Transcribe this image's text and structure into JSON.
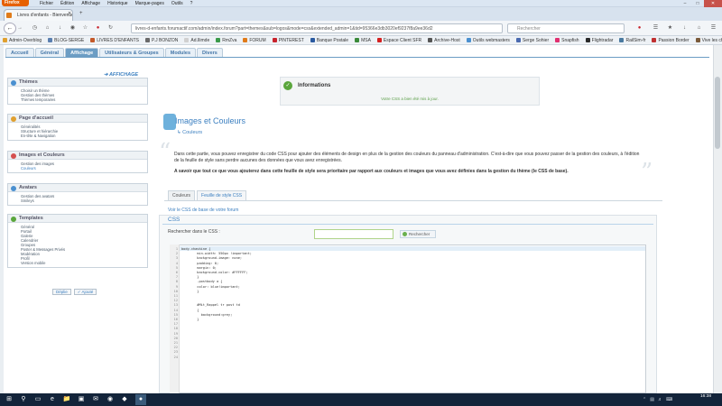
{
  "browser": {
    "app_button": "Firefox",
    "menus": [
      "Fichier",
      "Édition",
      "Affichage",
      "Historique",
      "Marque-pages",
      "Outils",
      "?"
    ],
    "tab_title": "Livres d'enfants - Bienvenue s...",
    "url": "livres-d-enfants.forumactif.com/admin/index.forum?part=themes&sub=logos&mode=css&extended_admin=1&tid=95366e3db3020ef9237f8a9ee36d2",
    "search_placeholder": "Rechercher",
    "bookmarks": [
      {
        "label": "Admin-Overblog",
        "color": "#e0a030"
      },
      {
        "label": "BLOG-SERGE",
        "color": "#5a7fb0"
      },
      {
        "label": "LIVRES D'ENFANTS",
        "color": "#c45a2a"
      },
      {
        "label": "P.J BONZON",
        "color": "#6a6a6a"
      },
      {
        "label": "Ad.Ilimde",
        "color": "#d0d0d0"
      },
      {
        "label": "RmZva",
        "color": "#3a9a4a"
      },
      {
        "label": "FORUM",
        "color": "#e07b1a"
      },
      {
        "label": "PINTEREST",
        "color": "#c8232c"
      },
      {
        "label": "Banque Postale",
        "color": "#2a5aa0"
      },
      {
        "label": "MSA",
        "color": "#3a8a3a"
      },
      {
        "label": "Espace Client SFR",
        "color": "#d52020"
      },
      {
        "label": "Archive-Host",
        "color": "#555555"
      },
      {
        "label": "Outils webmasters",
        "color": "#4a90d0"
      },
      {
        "label": "Serge Sohier",
        "color": "#4a6ab0"
      },
      {
        "label": "Snapfish",
        "color": "#e03070"
      },
      {
        "label": "Flightradar",
        "color": "#2a2a2a"
      },
      {
        "label": "RailSim-fr",
        "color": "#4a7aa0"
      },
      {
        "label": "Passion Border",
        "color": "#c03030"
      },
      {
        "label": "Vive les chiens",
        "color": "#7a5a3a"
      }
    ]
  },
  "admin": {
    "tabs": [
      "Accueil",
      "Général",
      "Affichage",
      "Utilisateurs & Groupes",
      "Modules",
      "Divers"
    ],
    "active_tab": "Affichage",
    "section_link": "AFFICHAGE",
    "sidebar": [
      {
        "title": "Thèmes",
        "icon_color": "#4a90d0",
        "items": [
          "Choisir un thème",
          "Gestion des thèmes",
          "Thèmes temporaires"
        ]
      },
      {
        "title": "Page d'accueil",
        "icon_color": "#e0a030",
        "items": [
          "Généralités",
          "Structure et hiérarchie",
          "En-tête & Navigation"
        ]
      },
      {
        "title": "Images et Couleurs",
        "icon_color": "#d55050",
        "items": [
          "Gestion des images",
          "Couleurs"
        ],
        "selected": "Couleurs"
      },
      {
        "title": "Avatars",
        "icon_color": "#4a90d0",
        "items": [
          "Gestion des avatars",
          "Smileys"
        ]
      },
      {
        "title": "Templates",
        "icon_color": "#5aa63c",
        "items": [
          "Général",
          "Portail",
          "Galerie",
          "Calendrier",
          "Groupes",
          "Poster & Messages Privés",
          "Modération",
          "Profil",
          "Version mobile"
        ]
      }
    ],
    "buttons": {
      "collapse": "Déplie",
      "expand": "Ajouté"
    }
  },
  "main": {
    "info_title": "Informations",
    "info_text": "Votre CSS a bien été mis à jour.",
    "page_title": "Images et Couleurs",
    "subtitle": "Couleurs",
    "desc1": "Dans cette partie, vous pouvez enregistrer du code CSS pour ajouter des éléments de design en plus de la gestion des couleurs du panneau d'administration. C'est-à-dire que vous pouvez passer de la gestion des couleurs, à l'édition de la feuille de style sans perdre aucunes des données que vous avez enregistrées.",
    "desc2": "A savoir que tout ce que vous ajouterez dans cette feuille de style sera prioritaire par rapport aux couleurs et images que vous avez définies dans la gestion du thème (le CSS de base).",
    "subtabs": [
      "Couleurs",
      "Feuille de style CSS"
    ],
    "css_base_link": "Voir le CSS de base de votre forum",
    "css_panel_title": "CSS",
    "search_label": "Rechercher dans le CSS :",
    "search_button": "Rechercher",
    "code_lines": [
      "body.chaskine {",
      "        min-width: 550px !important;",
      "        background-image: none;",
      "        padding: 0;",
      "        margin: 0;",
      "        background-color: #FFFFFF;",
      "        }",
      "        .postbody a {",
      "        color: blue!important;",
      "        }",
      "",
      "",
      "        #Mit_Rappel tr post td",
      "        {",
      "          background:grey;",
      "        }",
      "",
      "",
      "",
      "",
      "",
      "",
      "",
      ""
    ]
  },
  "taskbar": {
    "time": "16:38"
  }
}
